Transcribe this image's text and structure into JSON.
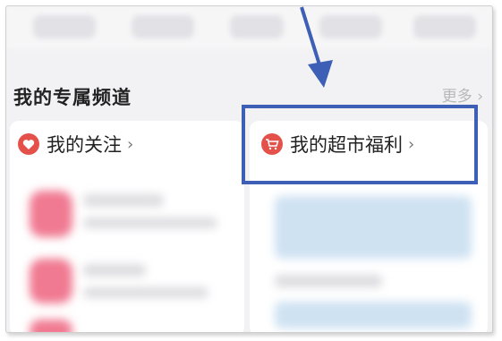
{
  "section": {
    "title": "我的专属频道",
    "more_label": "更多 ›"
  },
  "channels": [
    {
      "label": "我的关注",
      "icon": "heart-icon"
    },
    {
      "label": "我的超市福利",
      "icon": "shopping-cart-icon"
    }
  ],
  "chevron": "›",
  "colors": {
    "annotation_blue": "#3d5fb6",
    "icon_red": "#e4504a"
  }
}
